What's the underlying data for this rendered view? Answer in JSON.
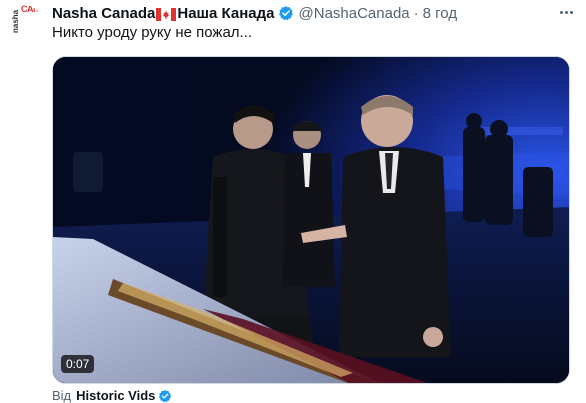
{
  "account": {
    "avatar_text_vertical": "nasha",
    "avatar_text_main": "CANADA",
    "name_latin": "Nasha Canada",
    "name_cyrillic": "Наша Канада",
    "flag_icon": "canada-flag-icon",
    "verified_icon": "verified-badge-icon",
    "handle": "@NashaCanada",
    "separator": "·",
    "time": "8 год"
  },
  "tweet": {
    "text": "Никто уроду руку не пожал..."
  },
  "media": {
    "duration": "0:07"
  },
  "source": {
    "prefix": "Від",
    "name": "Historic Vids"
  },
  "colors": {
    "verified": "#1d9bf0",
    "accent_red": "#e0322e",
    "muted_text": "#536471",
    "stage_blue": "#1c3aa8"
  }
}
